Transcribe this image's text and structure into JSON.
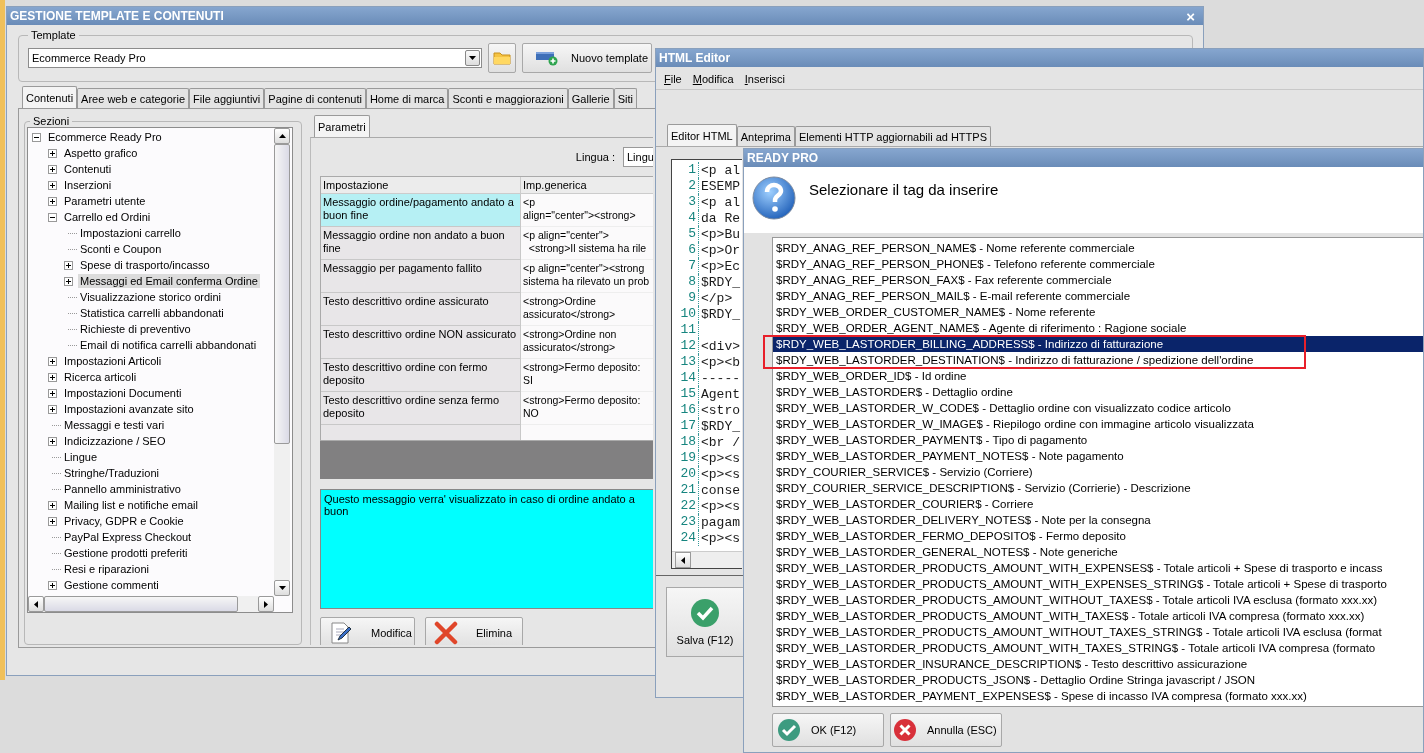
{
  "main_window": {
    "title": "GESTIONE TEMPLATE E CONTENUTI",
    "close": "×",
    "template_group": {
      "label": "Template",
      "value": "Ecommerce Ready Pro",
      "new_button": "Nuovo template"
    },
    "tabs": [
      {
        "label": "Contenuti",
        "selected": true
      },
      {
        "label": "Aree web e categorie",
        "selected": false
      },
      {
        "label": "File aggiuntivi",
        "selected": false
      },
      {
        "label": "Pagine di contenuti",
        "selected": false
      },
      {
        "label": "Home di marca",
        "selected": false
      },
      {
        "label": "Sconti e maggiorazioni",
        "selected": false
      },
      {
        "label": "Gallerie",
        "selected": false
      },
      {
        "label": "Siti",
        "selected": false
      }
    ],
    "sections": {
      "label": "Sezioni",
      "tree": [
        {
          "label": "Ecommerce Ready Pro",
          "expanded": true,
          "selected": false,
          "children": [
            {
              "label": "Aspetto grafico",
              "expanded": false,
              "selected": false
            },
            {
              "label": "Contenuti",
              "expanded": false,
              "selected": false
            },
            {
              "label": "Inserzioni",
              "expanded": false,
              "selected": false
            },
            {
              "label": "Parametri utente",
              "expanded": false,
              "selected": false
            },
            {
              "label": "Carrello ed Ordini",
              "expanded": true,
              "selected": false,
              "children": [
                {
                  "label": "Impostazioni carrello",
                  "selected": false
                },
                {
                  "label": "Sconti e Coupon",
                  "selected": false
                },
                {
                  "label": "Spese di trasporto/incasso",
                  "expanded": false,
                  "selected": false
                },
                {
                  "label": "Messaggi ed Email conferma Ordine",
                  "expanded": false,
                  "selected": true
                },
                {
                  "label": "Visualizzazione storico ordini",
                  "selected": false
                },
                {
                  "label": "Statistica carrelli abbandonati",
                  "selected": false
                },
                {
                  "label": "Richieste di preventivo",
                  "selected": false
                },
                {
                  "label": "Email di notifica carrelli abbandonati",
                  "selected": false
                }
              ]
            },
            {
              "label": "Impostazioni Articoli",
              "expanded": false,
              "selected": false
            },
            {
              "label": "Ricerca articoli",
              "expanded": false,
              "selected": false
            },
            {
              "label": "Impostazioni Documenti",
              "expanded": false,
              "selected": false
            },
            {
              "label": "Impostazioni avanzate sito",
              "expanded": false,
              "selected": false
            },
            {
              "label": "Messaggi e testi vari",
              "selected": false
            },
            {
              "label": "Indicizzazione / SEO",
              "expanded": false,
              "selected": false
            },
            {
              "label": "Lingue",
              "selected": false
            },
            {
              "label": "Stringhe/Traduzioni",
              "selected": false
            },
            {
              "label": "Pannello amministrativo",
              "selected": false
            },
            {
              "label": "Mailing list e notifiche email",
              "expanded": false,
              "selected": false
            },
            {
              "label": "Privacy, GDPR e Cookie",
              "expanded": false,
              "selected": false
            },
            {
              "label": "PayPal Express Checkout",
              "selected": false
            },
            {
              "label": "Gestione prodotti preferiti",
              "selected": false
            },
            {
              "label": "Resi e riparazioni",
              "selected": false
            },
            {
              "label": "Gestione commenti",
              "expanded": false,
              "selected": false
            }
          ]
        }
      ]
    },
    "parameters": {
      "tab": {
        "label": "Parametri",
        "selected": true
      },
      "language_label": "Lingua :",
      "language_value": "Lingu",
      "columns": [
        "Impostazione",
        "Imp.generica"
      ],
      "rows": [
        {
          "setting": "Messaggio ordine/pagamento andato a buon fine",
          "value": "<p\nalign=\"center\"><strong>",
          "selected": true
        },
        {
          "setting": "Messaggio ordine non andato a buon fine",
          "value": "<p align=\"center\">\n  <strong>Il sistema ha rile",
          "selected": false
        },
        {
          "setting": "Messaggio per pagamento fallito",
          "value": "<p align=\"center\"><strong\nsistema ha rilevato un prob",
          "selected": false
        },
        {
          "setting": "Testo descrittivo ordine assicurato",
          "value": "<strong>Ordine\nassicurato</strong>",
          "selected": false
        },
        {
          "setting": "Testo descrittivo ordine NON assicurato",
          "value": "<strong>Ordine non\nassicurato</strong>",
          "selected": false
        },
        {
          "setting": "Testo descrittivo ordine con fermo deposito",
          "value": "<strong>Fermo deposito:\nSI",
          "selected": false
        },
        {
          "setting": "Testo descrittivo ordine senza fermo deposito",
          "value": "<strong>Fermo deposito:\nNO",
          "selected": false
        }
      ],
      "description": "Questo messaggio verra' visualizzato in caso di ordine andato a buon",
      "buttons": [
        {
          "kind": "edit",
          "label": "Modifica"
        },
        {
          "kind": "delete",
          "label": "Elimina"
        }
      ]
    }
  },
  "editor_window": {
    "title": "HTML Editor",
    "menu": [
      "File",
      "Modifica",
      "Inserisci"
    ],
    "tabs": [
      {
        "label": "Editor HTML",
        "selected": true
      },
      {
        "label": "Anteprima",
        "selected": false
      },
      {
        "label": "Elementi HTTP aggiornabili ad HTTPS",
        "selected": false
      }
    ],
    "lines": [
      {
        "number": "1",
        "code": "<p al"
      },
      {
        "number": "2",
        "code": "ESEMP"
      },
      {
        "number": "3",
        "code": "<p al"
      },
      {
        "number": "4",
        "code": "da Re"
      },
      {
        "number": "5",
        "code": "<p>Bu"
      },
      {
        "number": "6",
        "code": "<p>Or"
      },
      {
        "number": "7",
        "code": "<p>Ec"
      },
      {
        "number": "8",
        "code": "$RDY_"
      },
      {
        "number": "9",
        "code": "</p>"
      },
      {
        "number": "10",
        "code": "$RDY_"
      },
      {
        "number": "11"
      },
      {
        "number": "12",
        "code": "<div>"
      },
      {
        "number": "13",
        "code": "<p><b"
      },
      {
        "number": "14",
        "code": "-----"
      },
      {
        "number": "15",
        "code": "Agent"
      },
      {
        "number": "16",
        "code": "<stro"
      },
      {
        "number": "17",
        "code": "$RDY_"
      },
      {
        "number": "18",
        "code": "<br /"
      },
      {
        "number": "19",
        "code": "<p><s"
      },
      {
        "number": "20",
        "code": "<p><s"
      },
      {
        "number": "21",
        "code": "conse"
      },
      {
        "number": "22",
        "code": "<p><s"
      },
      {
        "number": "23",
        "code": "pagam"
      },
      {
        "number": "24",
        "code": "<p><s"
      }
    ],
    "save_button": "Salva (F12)"
  },
  "dialog": {
    "title": "READY PRO",
    "prompt": "Selezionare il tag da inserire",
    "tags": [
      {
        "text": "$RDY_ANAG_REF_PERSON_NAME$ - Nome referente commerciale",
        "selected": false,
        "boxed": false
      },
      {
        "text": "$RDY_ANAG_REF_PERSON_PHONE$ - Telefono referente commerciale",
        "selected": false,
        "boxed": false
      },
      {
        "text": "$RDY_ANAG_REF_PERSON_FAX$ - Fax referente commerciale",
        "selected": false,
        "boxed": false
      },
      {
        "text": "$RDY_ANAG_REF_PERSON_MAIL$ - E-mail referente commerciale",
        "selected": false,
        "boxed": false
      },
      {
        "text": "$RDY_WEB_ORDER_CUSTOMER_NAME$ - Nome referente",
        "selected": false,
        "boxed": false
      },
      {
        "text": "$RDY_WEB_ORDER_AGENT_NAME$ - Agente di riferimento : Ragione sociale",
        "selected": false,
        "boxed": false
      },
      {
        "text": "$RDY_WEB_LASTORDER_BILLING_ADDRESS$ - Indirizzo di fatturazione",
        "selected": true,
        "boxed": true
      },
      {
        "text": "$RDY_WEB_LASTORDER_DESTINATION$ - Indirizzo di fatturazione / spedizione dell'ordine",
        "selected": false,
        "boxed": true
      },
      {
        "text": "$RDY_WEB_ORDER_ID$ - Id ordine",
        "selected": false,
        "boxed": false
      },
      {
        "text": "$RDY_WEB_LASTORDER$ - Dettaglio ordine",
        "selected": false,
        "boxed": false
      },
      {
        "text": "$RDY_WEB_LASTORDER_W_CODE$ - Dettaglio ordine con visualizzato codice articolo",
        "selected": false,
        "boxed": false
      },
      {
        "text": "$RDY_WEB_LASTORDER_W_IMAGE$ - Riepilogo ordine con immagine articolo visualizzata",
        "selected": false,
        "boxed": false
      },
      {
        "text": "$RDY_WEB_LASTORDER_PAYMENT$ - Tipo di pagamento",
        "selected": false,
        "boxed": false
      },
      {
        "text": "$RDY_WEB_LASTORDER_PAYMENT_NOTES$ - Note pagamento",
        "selected": false,
        "boxed": false
      },
      {
        "text": "$RDY_COURIER_SERVICE$ - Servizio (Corriere)",
        "selected": false,
        "boxed": false
      },
      {
        "text": "$RDY_COURIER_SERVICE_DESCRIPTION$ - Servizio (Corrierie) - Descrizione",
        "selected": false,
        "boxed": false
      },
      {
        "text": "$RDY_WEB_LASTORDER_COURIER$ - Corriere",
        "selected": false,
        "boxed": false
      },
      {
        "text": "$RDY_WEB_LASTORDER_DELIVERY_NOTES$ - Note per la consegna",
        "selected": false,
        "boxed": false
      },
      {
        "text": "$RDY_WEB_LASTORDER_FERMO_DEPOSITO$ - Fermo deposito",
        "selected": false,
        "boxed": false
      },
      {
        "text": "$RDY_WEB_LASTORDER_GENERAL_NOTES$ - Note generiche",
        "selected": false,
        "boxed": false
      },
      {
        "text": "$RDY_WEB_LASTORDER_PRODUCTS_AMOUNT_WITH_EXPENSES$ - Totale articoli + Spese di trasporto e incass",
        "selected": false,
        "boxed": false
      },
      {
        "text": "$RDY_WEB_LASTORDER_PRODUCTS_AMOUNT_WITH_EXPENSES_STRING$ - Totale articoli + Spese di trasporto",
        "selected": false,
        "boxed": false
      },
      {
        "text": "$RDY_WEB_LASTORDER_PRODUCTS_AMOUNT_WITHOUT_TAXES$ - Totale articoli IVA esclusa (formato xxx.xx)",
        "selected": false,
        "boxed": false
      },
      {
        "text": "$RDY_WEB_LASTORDER_PRODUCTS_AMOUNT_WITH_TAXES$ - Totale articoli IVA compresa (formato xxx.xx)",
        "selected": false,
        "boxed": false
      },
      {
        "text": "$RDY_WEB_LASTORDER_PRODUCTS_AMOUNT_WITHOUT_TAXES_STRING$ - Totale articoli IVA esclusa (format",
        "selected": false,
        "boxed": false
      },
      {
        "text": "$RDY_WEB_LASTORDER_PRODUCTS_AMOUNT_WITH_TAXES_STRING$ - Totale articoli IVA compresa (formato",
        "selected": false,
        "boxed": false
      },
      {
        "text": "$RDY_WEB_LASTORDER_INSURANCE_DESCRIPTION$ - Testo descrittivo assicurazione",
        "selected": false,
        "boxed": false
      },
      {
        "text": "$RDY_WEB_LASTORDER_PRODUCTS_JSON$ - Dettaglio Ordine Stringa javascript / JSON",
        "selected": false,
        "boxed": false
      },
      {
        "text": "$RDY_WEB_LASTORDER_PAYMENT_EXPENSES$ - Spese di incasso IVA compresa (formato xxx.xx)",
        "selected": false,
        "boxed": false
      }
    ],
    "buttons": [
      {
        "kind": "ok",
        "label": "OK (F12)"
      },
      {
        "kind": "cancel",
        "label": "Annulla (ESC)"
      }
    ]
  }
}
